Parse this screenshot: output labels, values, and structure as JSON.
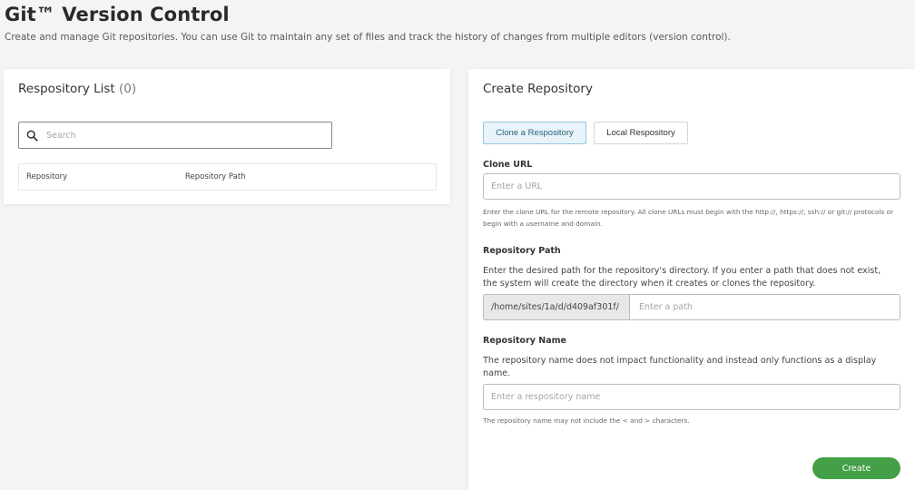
{
  "page": {
    "title": "Git™ Version Control",
    "description": "Create and manage Git repositories. You can use Git to maintain any set of files and track the history of changes from multiple editors (version control)."
  },
  "repo_list": {
    "title": "Respository List",
    "count": "(0)",
    "search_placeholder": "Search",
    "columns": [
      "Repository",
      "Repository Path"
    ]
  },
  "create": {
    "title": "Create Repository",
    "tabs": [
      {
        "label": "Clone a Respository",
        "active": true
      },
      {
        "label": "Local Respository",
        "active": false
      }
    ],
    "clone_url": {
      "label": "Clone URL",
      "placeholder": "Enter a URL",
      "help": "Enter the clone URL for the remote repository. All clone URLs must begin with the http://, https://, ssh:// or git:// protocols or begin with a username and domain."
    },
    "repo_path": {
      "label": "Repository Path",
      "help": "Enter the desired path for the repository's directory. If you enter a path that does not exist, the system will create the directory when it creates or clones the repository.",
      "prefix": "/home/sites/1a/d/d409af301f/",
      "placeholder": "Enter a path"
    },
    "repo_name": {
      "label": "Repository Name",
      "help": "The repository name does not impact functionality and instead only functions as a display name.",
      "placeholder": "Enter a respository name",
      "note": "The repository name may not include the < and > characters."
    },
    "create_label": "Create"
  },
  "colors": {
    "accent_green": "#43a047",
    "active_tab_border": "#8fc5e0",
    "active_tab_bg": "#e8f4fa"
  }
}
